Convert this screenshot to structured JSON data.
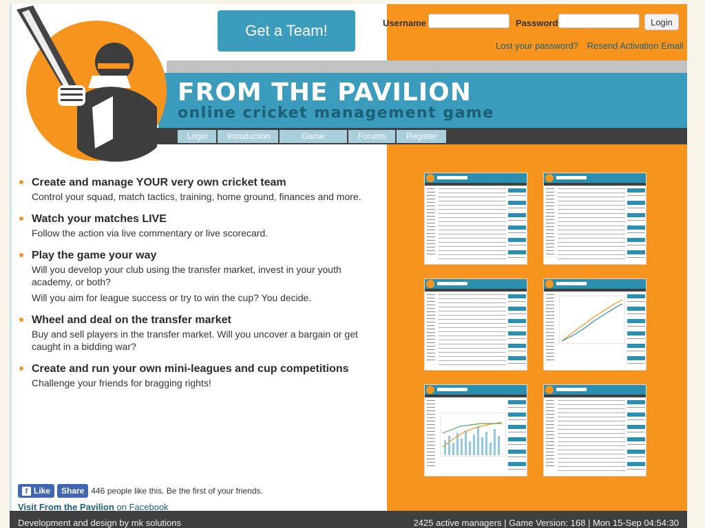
{
  "header": {
    "title": "FROM THE PAVILION",
    "subtitle": "online cricket management game",
    "cta": "Get a Team!"
  },
  "nav": [
    "Login",
    "Introduction",
    "Game Manual",
    "Forums",
    "Register"
  ],
  "login": {
    "username_label": "Username",
    "password_label": "Password",
    "button": "Login",
    "lost_password": "Lost your password?",
    "resend": "Resend Activation Email"
  },
  "features": [
    {
      "title": "Create and manage YOUR very own cricket team",
      "text": "Control your squad, match tactics, training, home ground, finances and more."
    },
    {
      "title": "Watch your matches LIVE",
      "text": "Follow the action via live commentary or live scorecard."
    },
    {
      "title": "Play the game your way",
      "text": "Will you develop your club using the transfer market, invest in your youth academy, or both?",
      "text2": "Will you aim for league success or try to win the cup? You decide."
    },
    {
      "title": "Wheel and deal on the transfer market",
      "text": "Buy and sell players in the transfer market. Will you uncover a bargain or get caught in a bidding war?"
    },
    {
      "title": "Create and run your own mini-leagues and cup competitions",
      "text": "Challenge your friends for bragging rights!"
    }
  ],
  "facebook": {
    "like": "Like",
    "share": "Share",
    "count_text": "446 people like this. Be the first of your friends.",
    "visit_bold": "Visit From the Pavilion",
    "visit_rest": " on Facebook"
  },
  "footer": {
    "left": "Development and design by mk solutions",
    "right": "2425 active managers | Game Version: 168 | Mon 15-Sep 04:54:30"
  },
  "colors": {
    "accent": "#f7941d",
    "brand": "#3b9cbd",
    "dark": "#3f3f3f"
  }
}
